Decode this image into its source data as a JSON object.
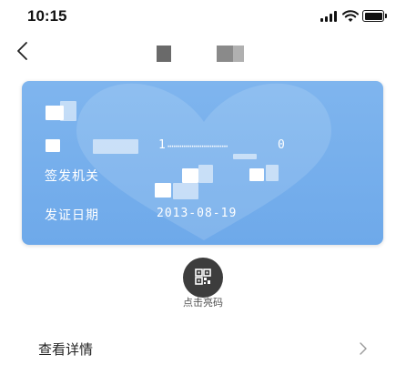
{
  "status_bar": {
    "time": "10:15",
    "icons": [
      "signal-icon",
      "wifi-icon",
      "battery-icon"
    ]
  },
  "nav": {
    "back_icon": "chevron-left-icon"
  },
  "card": {
    "background_color": "#6aa7ea",
    "issuing_authority_label": "签发机关",
    "issue_date_label": "发证日期",
    "issue_date_value": "2013-08-19",
    "number_start": "1",
    "number_end": "0"
  },
  "code_action": {
    "icon": "qr-code-icon",
    "label": "点击亮码"
  },
  "detail_row": {
    "label": "查看详情",
    "icon": "chevron-right-icon"
  }
}
